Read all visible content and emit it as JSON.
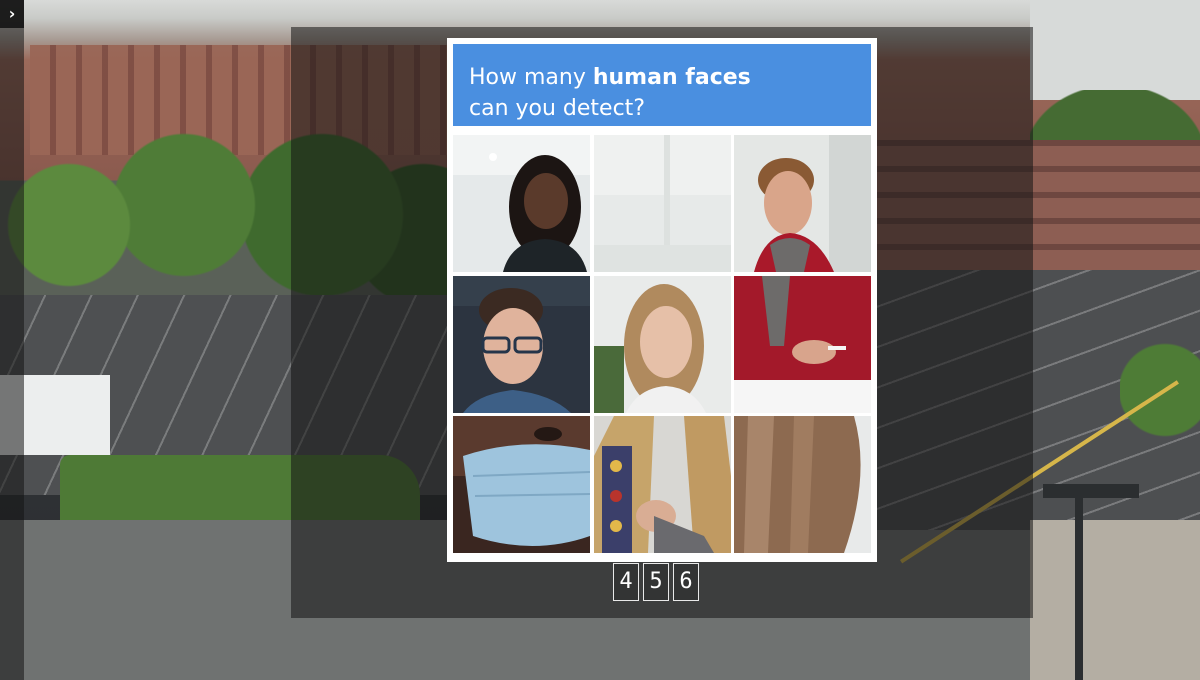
{
  "side_toggle": {
    "icon": "chevron-right-icon",
    "glyph": "›"
  },
  "captcha": {
    "prompt_prefix": "How many ",
    "prompt_bold": "human faces",
    "prompt_line2": "can you detect?",
    "header_color": "#4a8fe0",
    "tiles": [
      "woman-portrait-tile",
      "empty-office-tile",
      "man-red-sweater-tile",
      "man-glasses-tile",
      "woman-blonde-tile",
      "man-red-sweater-lower-tile",
      "masked-person-tile",
      "woman-patterned-shirt-tile",
      "hair-back-of-head-tile"
    ]
  },
  "answers": [
    "4",
    "5",
    "6"
  ]
}
